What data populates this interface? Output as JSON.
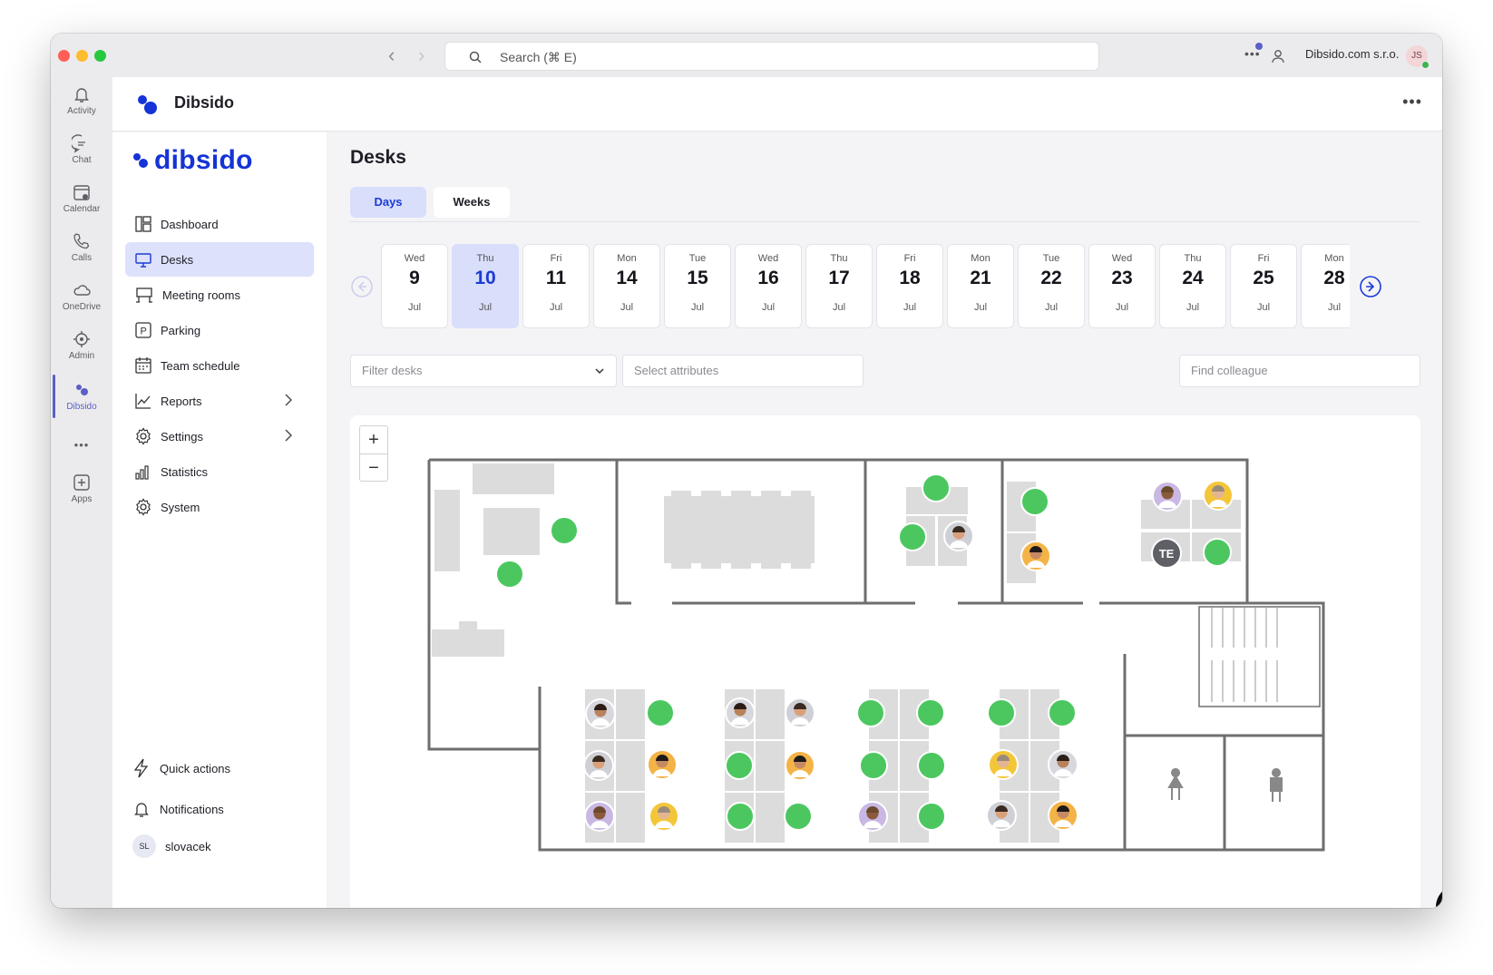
{
  "titlebar": {
    "search_placeholder": "Search (⌘ E)",
    "org_name": "Dibsido.com s.r.o.",
    "user_initials": "JS"
  },
  "rail": {
    "items": [
      {
        "label": "Activity",
        "icon": "bell-icon"
      },
      {
        "label": "Chat",
        "icon": "chat-icon"
      },
      {
        "label": "Calendar",
        "icon": "calendar-icon"
      },
      {
        "label": "Calls",
        "icon": "phone-icon"
      },
      {
        "label": "OneDrive",
        "icon": "cloud-icon"
      },
      {
        "label": "Admin",
        "icon": "admin-icon"
      },
      {
        "label": "Dibsido",
        "icon": "dibsido-icon",
        "active": true
      },
      {
        "label": "Apps",
        "icon": "add-app-icon"
      }
    ],
    "more": "•••"
  },
  "header": {
    "title": "Dibsido",
    "more": "•••"
  },
  "sidebar": {
    "brand": "dibsido",
    "items": [
      {
        "label": "Dashboard",
        "icon": "dashboard-icon"
      },
      {
        "label": "Desks",
        "icon": "desk-icon",
        "active": true
      },
      {
        "label": "Meeting rooms",
        "icon": "meeting-room-icon"
      },
      {
        "label": "Parking",
        "icon": "parking-icon"
      },
      {
        "label": "Team schedule",
        "icon": "team-schedule-icon"
      },
      {
        "label": "Reports",
        "icon": "reports-icon",
        "expandable": true
      },
      {
        "label": "Settings",
        "icon": "settings-icon",
        "expandable": true
      },
      {
        "label": "Statistics",
        "icon": "statistics-icon"
      },
      {
        "label": "System",
        "icon": "system-icon"
      }
    ],
    "quick_actions": "Quick actions",
    "notifications": "Notifications",
    "user": {
      "initials": "SL",
      "name": "slovacek"
    }
  },
  "main": {
    "title": "Desks",
    "tabs": [
      {
        "label": "Days",
        "active": true
      },
      {
        "label": "Weeks",
        "active": false
      }
    ],
    "dates": [
      {
        "weekday": "Wed",
        "day": "9",
        "month": "Jul"
      },
      {
        "weekday": "Thu",
        "day": "10",
        "month": "Jul",
        "selected": true
      },
      {
        "weekday": "Fri",
        "day": "11",
        "month": "Jul"
      },
      {
        "weekday": "Mon",
        "day": "14",
        "month": "Jul"
      },
      {
        "weekday": "Tue",
        "day": "15",
        "month": "Jul"
      },
      {
        "weekday": "Wed",
        "day": "16",
        "month": "Jul"
      },
      {
        "weekday": "Thu",
        "day": "17",
        "month": "Jul"
      },
      {
        "weekday": "Fri",
        "day": "18",
        "month": "Jul"
      },
      {
        "weekday": "Mon",
        "day": "21",
        "month": "Jul"
      },
      {
        "weekday": "Tue",
        "day": "22",
        "month": "Jul"
      },
      {
        "weekday": "Wed",
        "day": "23",
        "month": "Jul"
      },
      {
        "weekday": "Thu",
        "day": "24",
        "month": "Jul"
      },
      {
        "weekday": "Fri",
        "day": "25",
        "month": "Jul"
      },
      {
        "weekday": "Mon",
        "day": "28",
        "month": "Jul"
      }
    ],
    "filter_desks_placeholder": "Filter desks",
    "select_attributes_placeholder": "Select attributes",
    "find_colleague_placeholder": "Find colleague",
    "zoom_in": "+",
    "zoom_out": "−",
    "occupant_initials": "TE",
    "colors": {
      "accent": "#1b3bd6",
      "free_desk": "#4cc760",
      "selected_bg": "#d9defb",
      "wall": "#6e6e6e",
      "furniture": "#dcdcdc"
    }
  }
}
